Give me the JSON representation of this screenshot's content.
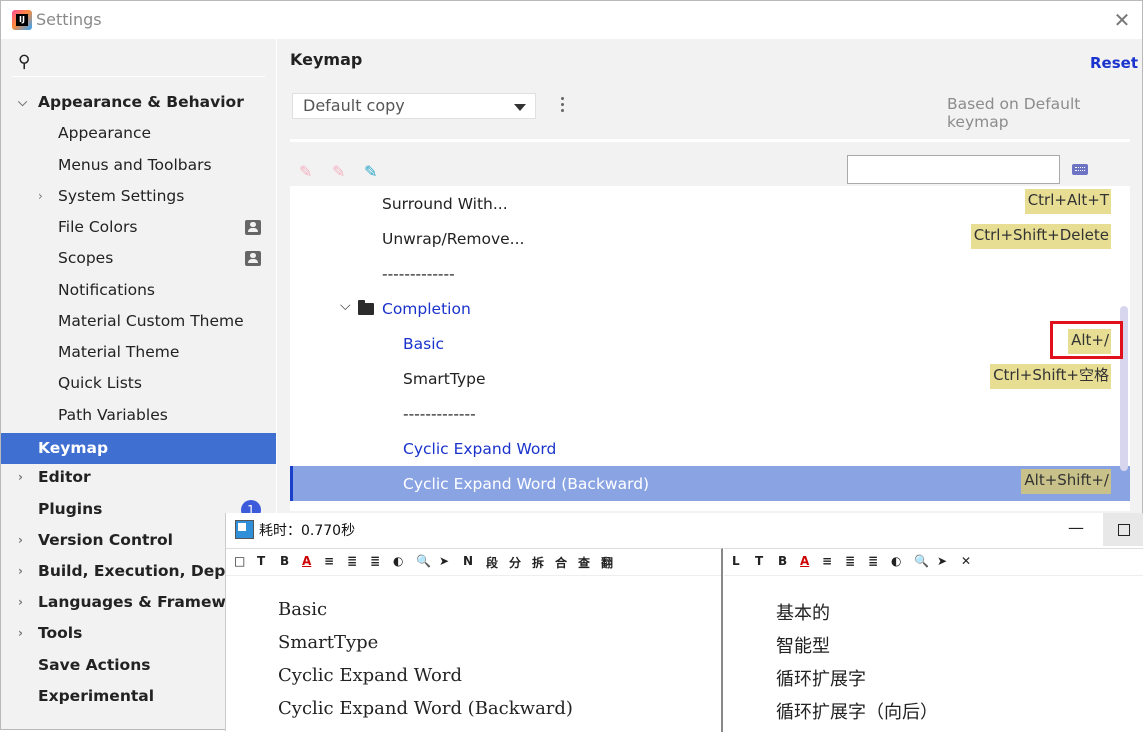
{
  "window": {
    "title": "Settings"
  },
  "sidebar": {
    "search_placeholder": "",
    "items": [
      {
        "label": "Appearance & Behavior",
        "bold": true,
        "arrow": "down"
      },
      {
        "label": "Appearance"
      },
      {
        "label": "Menus and Toolbars"
      },
      {
        "label": "System Settings",
        "arrow": "right"
      },
      {
        "label": "File Colors"
      },
      {
        "label": "Scopes"
      },
      {
        "label": "Notifications"
      },
      {
        "label": "Material Custom Theme"
      },
      {
        "label": "Material Theme"
      },
      {
        "label": "Quick Lists"
      },
      {
        "label": "Path Variables"
      },
      {
        "label": "Keymap",
        "bold": true,
        "selected": true
      },
      {
        "label": "Editor",
        "bold": true,
        "arrow": "right"
      },
      {
        "label": "Plugins",
        "bold": true,
        "badge": "1"
      },
      {
        "label": "Version Control",
        "bold": true,
        "arrow": "right"
      },
      {
        "label": "Build, Execution, Deployment",
        "bold": true,
        "arrow": "right"
      },
      {
        "label": "Languages & Frameworks",
        "bold": true,
        "arrow": "right"
      },
      {
        "label": "Tools",
        "bold": true,
        "arrow": "right"
      },
      {
        "label": "Save Actions",
        "bold": true
      },
      {
        "label": "Experimental",
        "bold": true
      }
    ]
  },
  "main": {
    "title": "Keymap",
    "reset_label": "Reset",
    "keymap_select": "Default copy",
    "based_on": "Based on Default keymap",
    "filter_value": "",
    "rows": [
      {
        "label": "Surround With...",
        "shortcut": "Ctrl+Alt+T"
      },
      {
        "label": "Unwrap/Remove...",
        "shortcut": "Ctrl+Shift+Delete"
      },
      {
        "label": "-------------",
        "shortcut": ""
      },
      {
        "label": "Completion",
        "shortcut": "",
        "folder": true
      },
      {
        "label": "Basic",
        "shortcut": "Alt+/"
      },
      {
        "label": "SmartType",
        "shortcut": "Ctrl+Shift+空格"
      },
      {
        "label": "-------------",
        "shortcut": ""
      },
      {
        "label": "Cyclic Expand Word",
        "shortcut": ""
      },
      {
        "label": "Cyclic Expand Word (Backward)",
        "shortcut": "Alt+Shift+/",
        "selected": true
      }
    ]
  },
  "popup": {
    "title": "耗时：0.770秒",
    "left_toolbar": [
      "□",
      "T",
      "B",
      "A",
      "≡",
      "≣",
      "≣",
      "◐",
      "🔍",
      "➤",
      "N",
      "段",
      "分",
      "拆",
      "合",
      "查",
      "翻"
    ],
    "right_toolbar": [
      "L",
      "T",
      "B",
      "A",
      "≡",
      "≣",
      "≣",
      "◐",
      "🔍",
      "➤",
      "✕"
    ],
    "left_lines": [
      "Basic",
      "SmartType",
      "Cyclic Expand Word",
      "Cyclic Expand Word (Backward)"
    ],
    "right_lines": [
      "基本的",
      "智能型",
      "循环扩展字",
      "循环扩展字（向后）"
    ]
  },
  "colors": {
    "selection": "#3f6fd1",
    "link": "#1a33cc",
    "shortcut_bg": "#e7de94",
    "highlight_box": "#e0101c"
  }
}
